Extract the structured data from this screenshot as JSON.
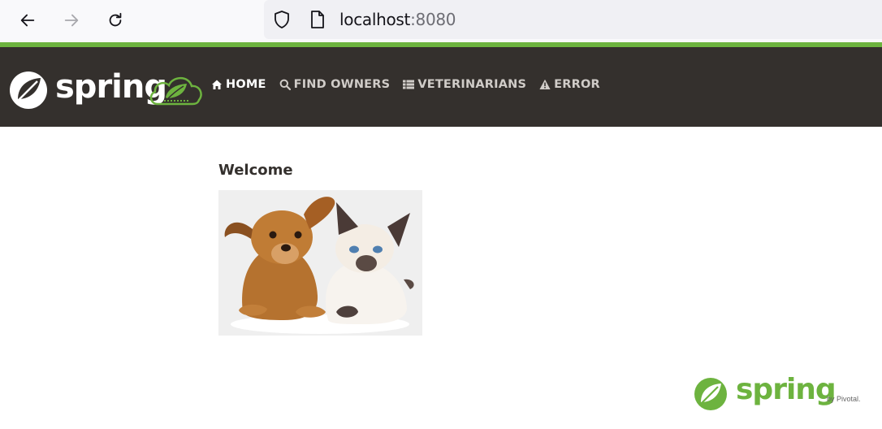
{
  "browser": {
    "url_host": "localhost",
    "url_port": ":8080"
  },
  "navbar": {
    "brand": "spring",
    "items": [
      {
        "label": "HOME",
        "icon": "home-icon",
        "active": true
      },
      {
        "label": "FIND OWNERS",
        "icon": "search-icon",
        "active": false
      },
      {
        "label": "VETERINARIANS",
        "icon": "list-icon",
        "active": false
      },
      {
        "label": "ERROR",
        "icon": "warning-icon",
        "active": false
      }
    ]
  },
  "main": {
    "heading": "Welcome"
  },
  "footer": {
    "logo_text": "spring",
    "by_text": "by Pivotal."
  },
  "colors": {
    "brand_green": "#6db33f",
    "navbar_bg": "#34302d"
  }
}
